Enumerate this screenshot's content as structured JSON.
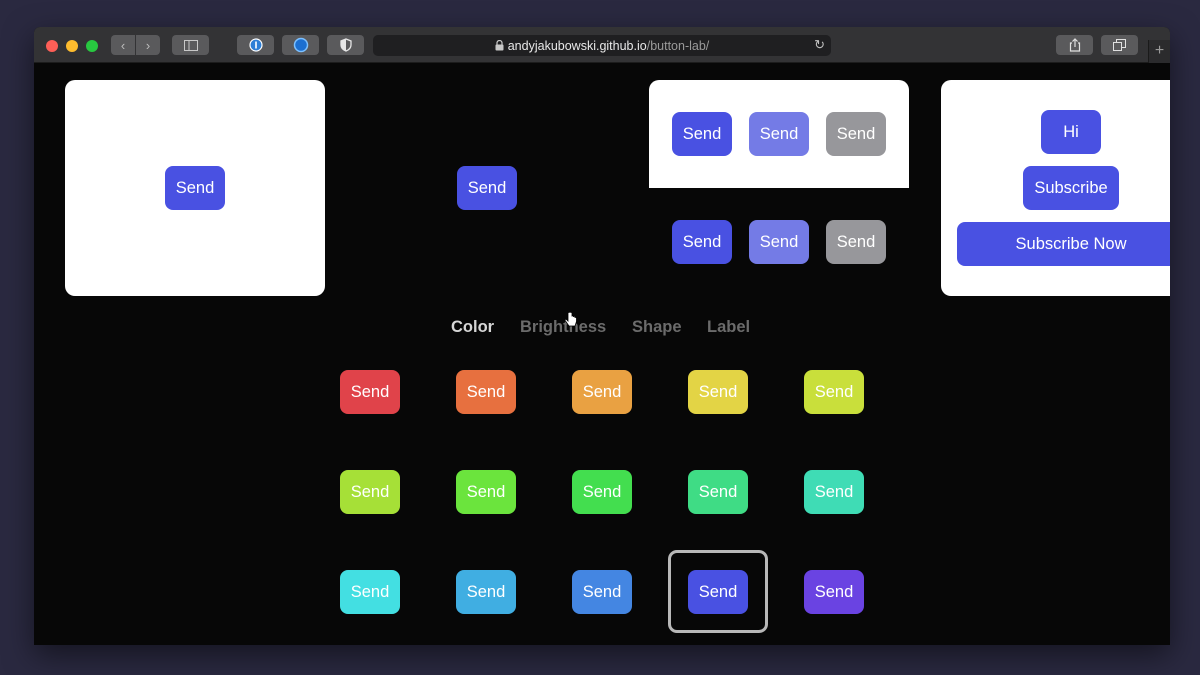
{
  "browser": {
    "url_host": "andyjakubowski.github.io",
    "url_path": "/button-lab/",
    "icons": {
      "back": "chevron-left-icon",
      "forward": "chevron-right-icon",
      "sidebar": "sidebar-icon",
      "password": "password-manager-icon",
      "extension": "extension-icon",
      "shield": "shield-icon",
      "lock": "lock-icon",
      "reload": "reload-icon",
      "share": "share-icon",
      "tabs": "tabs-overview-icon",
      "new_tab": "plus-icon"
    }
  },
  "colors": {
    "primary": "#4951e2",
    "primary_light": "#747be6",
    "gray": "#97979b",
    "background": "#070707",
    "traffic_red": "#fe5f57",
    "traffic_yellow": "#febc2e",
    "traffic_green": "#28c840"
  },
  "showcase": {
    "card_white_button": "Send",
    "dark_button": "Send",
    "states_light": [
      "Send",
      "Send",
      "Send"
    ],
    "states_dark": [
      "Send",
      "Send",
      "Send"
    ],
    "sizes": {
      "small": "Hi",
      "medium": "Subscribe",
      "large": "Subscribe Now"
    }
  },
  "tabs": [
    {
      "label": "Color",
      "active": true
    },
    {
      "label": "Brightness",
      "active": false
    },
    {
      "label": "Shape",
      "active": false
    },
    {
      "label": "Label",
      "active": false
    }
  ],
  "color_grid": {
    "selected_index": 13,
    "buttons": [
      {
        "label": "Send",
        "color": "#e0434a"
      },
      {
        "label": "Send",
        "color": "#e7703f"
      },
      {
        "label": "Send",
        "color": "#e9a142"
      },
      {
        "label": "Send",
        "color": "#e3d445"
      },
      {
        "label": "Send",
        "color": "#c9df3b"
      },
      {
        "label": "Send",
        "color": "#a6e037"
      },
      {
        "label": "Send",
        "color": "#6be43d"
      },
      {
        "label": "Send",
        "color": "#43de4f"
      },
      {
        "label": "Send",
        "color": "#3fdc85"
      },
      {
        "label": "Send",
        "color": "#3fdcb5"
      },
      {
        "label": "Send",
        "color": "#43dfe2"
      },
      {
        "label": "Send",
        "color": "#40aee2"
      },
      {
        "label": "Send",
        "color": "#4486e2"
      },
      {
        "label": "Send",
        "color": "#4951e2"
      },
      {
        "label": "Send",
        "color": "#6a43e2"
      }
    ]
  }
}
